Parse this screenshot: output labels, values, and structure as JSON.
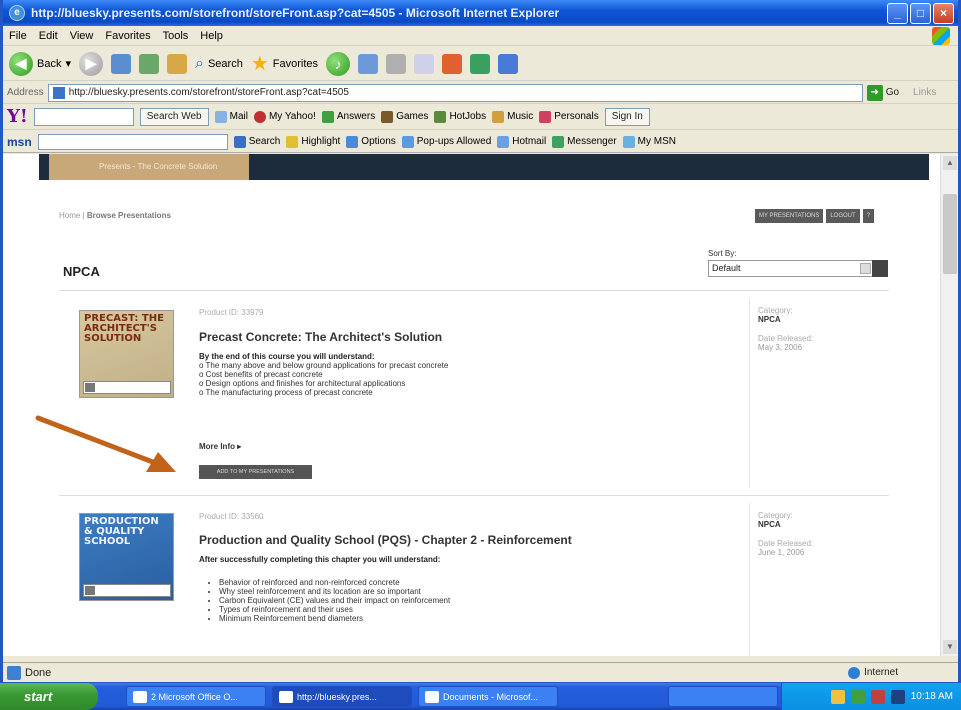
{
  "browser": {
    "title": "http://bluesky.presents.com/storefront/storeFront.asp?cat=4505 - Microsoft Internet Explorer",
    "menu": [
      "File",
      "Edit",
      "View",
      "Favorites",
      "Tools",
      "Help"
    ],
    "toolbar": {
      "back": "Back",
      "search": "Search",
      "favorites": "Favorites"
    },
    "address_label": "Address",
    "address": "http://bluesky.presents.com/storefront/storeFront.asp?cat=4505",
    "go": "Go",
    "links": "Links"
  },
  "yahoo": {
    "logo": "Y!",
    "search_web": "Search Web",
    "items": [
      "Mail",
      "My Yahoo!",
      "Answers",
      "Games",
      "HotJobs",
      "Music",
      "Personals"
    ],
    "sign_in": "Sign In"
  },
  "msn": {
    "logo": "msn",
    "items": [
      "Search",
      "Highlight",
      "Options",
      "Pop-ups Allowed",
      "Hotmail",
      "Messenger",
      "My MSN"
    ]
  },
  "page": {
    "header_tab": "Presents - The Concrete Solution",
    "breadcrumb_home": "Home",
    "breadcrumb_current": "Browse Presentations",
    "top_buttons": [
      "MY PRESENTATIONS",
      "LOGOUT",
      "?"
    ],
    "category_title": "NPCA",
    "sort_label": "Sort By:",
    "sort_value": "Default"
  },
  "products": [
    {
      "thumb_title": "PRECAST: THE ARCHITECT'S SOLUTION",
      "product_id": "Product ID: 33979",
      "title": "Precast Concrete: The Architect's Solution",
      "intro": "By the end of this course you will understand:",
      "points": [
        "o The many above and below ground applications for precast concrete",
        "o Cost benefits of precast concrete",
        "o Design options and finishes for architectural applications",
        "o The manufacturing process of precast concrete"
      ],
      "more_info": "More Info ▸",
      "add_button": "ADD TO MY PRESENTATIONS",
      "category_label": "Category:",
      "category": "NPCA",
      "date_label": "Date Released:",
      "date": "May 3, 2006"
    },
    {
      "thumb_title": "PRODUCTION & QUALITY SCHOOL",
      "product_id": "Product ID: 33560",
      "title": "Production and Quality School (PQS) - Chapter 2 - Reinforcement",
      "intro": "After successfully completing this chapter you will understand:",
      "points": [
        "Behavior of reinforced and non-reinforced concrete",
        "Why steel reinforcement and its location are so important",
        "Carbon Equivalent (CE) values and their impact on reinforcement",
        "Types of reinforcement and their uses",
        "Minimum Reinforcement bend diameters"
      ],
      "category_label": "Category:",
      "category": "NPCA",
      "date_label": "Date Released:",
      "date": "June 1, 2006"
    }
  ],
  "status": {
    "text": "Done",
    "zone": "Internet"
  },
  "taskbar": {
    "start": "start",
    "tasks": [
      "2 Microsoft Office O...",
      "http://bluesky.pres...",
      "Documents - Microsof..."
    ],
    "clock": "10:18 AM"
  }
}
